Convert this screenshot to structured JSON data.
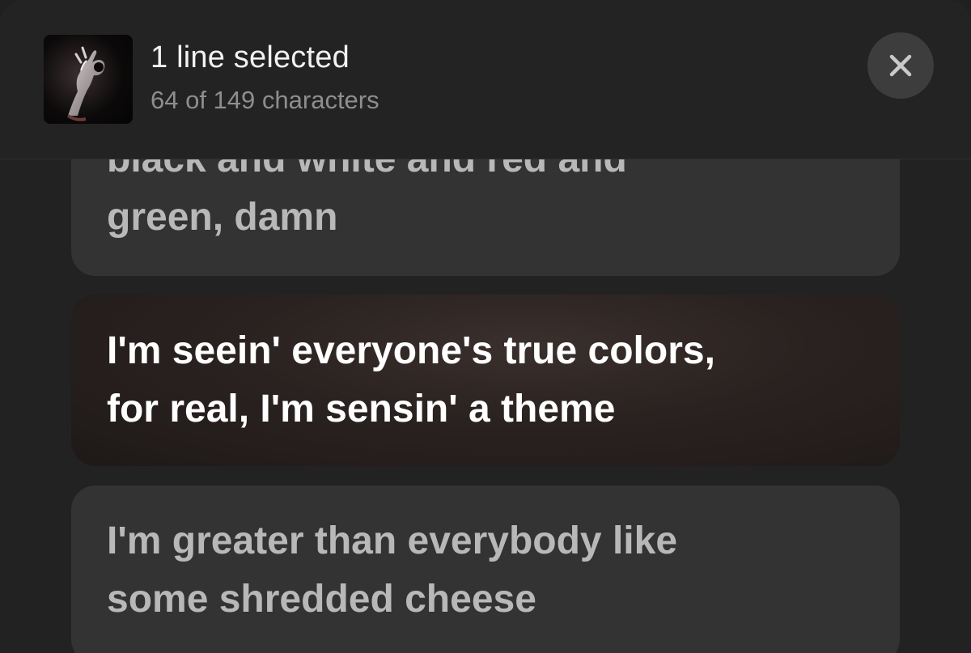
{
  "header": {
    "title": "1 line selected",
    "subtitle": "64 of 149 characters",
    "close_label": "close"
  },
  "artwork": {
    "icon": "hand-ok-gesture-artwork"
  },
  "lyrics": [
    {
      "lines": [
        "black and white and red and",
        "green, damn"
      ],
      "selected": false
    },
    {
      "lines": [
        "I'm seein' everyone's true colors,",
        "for real, I'm sensin' a theme"
      ],
      "selected": true
    },
    {
      "lines": [
        "I'm greater than everybody like",
        "some shredded cheese"
      ],
      "selected": false
    }
  ],
  "colors": {
    "background": "#222222",
    "card": "#333333",
    "selected_text": "#ffffff",
    "unselected_text": "#b8b8b8",
    "close_button": "#3d3d3d"
  }
}
